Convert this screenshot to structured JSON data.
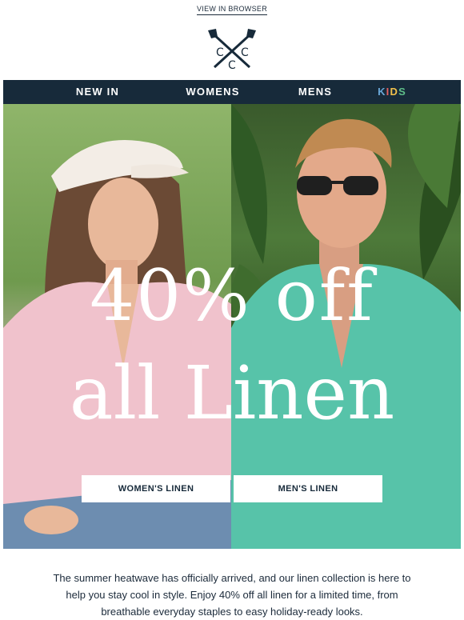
{
  "header": {
    "view_in_browser": "VIEW IN BROWSER",
    "logo_icon": "crossed-oars-ccc-logo",
    "logo_letters": [
      "C",
      "C",
      "C"
    ]
  },
  "nav": {
    "items": [
      {
        "label": "NEW IN"
      },
      {
        "label": "WOMENS"
      },
      {
        "label": "MENS"
      },
      {
        "label": "KIDS",
        "letter_colors": [
          "#6aa8d8",
          "#e85f5f",
          "#f1c04c",
          "#5fbf8a"
        ]
      }
    ]
  },
  "hero": {
    "headline_line1": "40% off",
    "headline_line2": "all Linen",
    "left_image": "woman-in-pink-linen-shirt-and-cap",
    "right_image": "man-in-mint-linen-shirt-and-sunglasses",
    "cta_women": "WOMEN'S LINEN",
    "cta_men": "MEN'S LINEN"
  },
  "body": {
    "copy": "The summer heatwave has officially arrived, and our linen collection is here to help you stay cool in style. Enjoy 40% off all linen for a limited time, from breathable everyday staples to easy holiday-ready looks."
  },
  "colors": {
    "navy": "#172a3a",
    "white": "#ffffff"
  }
}
